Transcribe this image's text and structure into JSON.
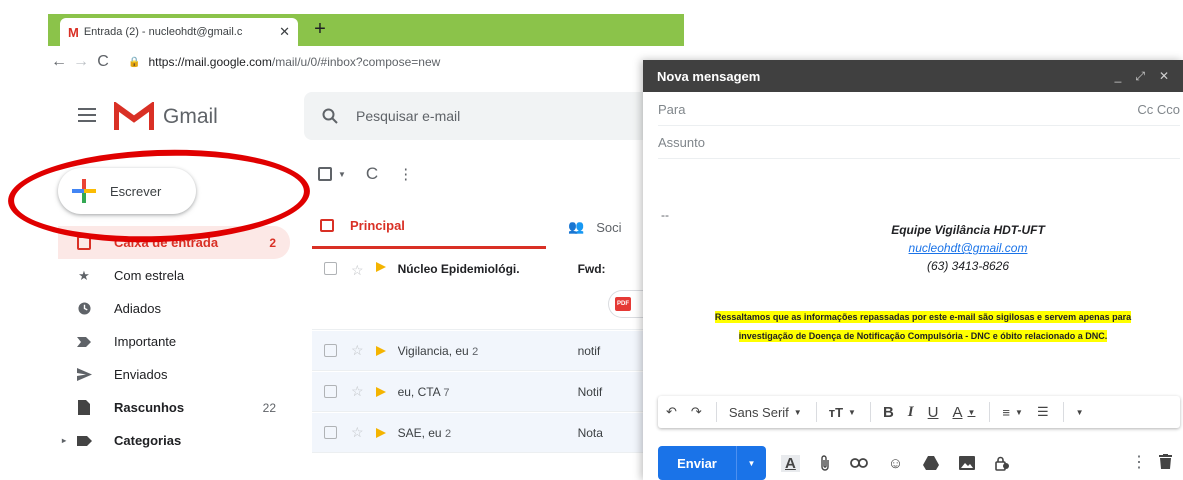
{
  "browser": {
    "tab_title": "Entrada (2) - nucleohdt@gmail.c",
    "tab_icon": "gmail-icon",
    "url_host": "https://mail.google.com",
    "url_path": "/mail/u/0/#inbox?compose=new"
  },
  "gmail": {
    "logo_text": "Gmail",
    "search_placeholder": "Pesquisar e-mail",
    "compose_label": "Escrever",
    "sidebar": [
      {
        "icon": "inbox-icon",
        "label": "Caixa de entrada",
        "count": "2"
      },
      {
        "icon": "star-icon",
        "label": "Com estrela",
        "count": ""
      },
      {
        "icon": "clock-icon",
        "label": "Adiados",
        "count": ""
      },
      {
        "icon": "important-icon",
        "label": "Importante",
        "count": ""
      },
      {
        "icon": "send-icon",
        "label": "Enviados",
        "count": ""
      },
      {
        "icon": "draft-icon",
        "label": "Rascunhos",
        "count": "22"
      },
      {
        "icon": "label-icon",
        "label": "Categorias",
        "count": ""
      }
    ],
    "tabs": {
      "principal": "Principal",
      "social": "Soci"
    },
    "emails": [
      {
        "sender": "Núcleo Epidemiológi.",
        "count": "",
        "subject": "Fwd:",
        "unread": true
      },
      {
        "sender": "Vigilancia, eu",
        "count": "2",
        "subject": "notif",
        "unread": false
      },
      {
        "sender": "eu, CTA",
        "count": "7",
        "subject": "Notif",
        "unread": false
      },
      {
        "sender": "SAE, eu",
        "count": "2",
        "subject": "Nota",
        "unread": false
      }
    ],
    "attachment_badge": "PDF"
  },
  "compose": {
    "title": "Nova mensagem",
    "to_label": "Para",
    "cc_bcc": "Cc Cco",
    "subject_label": "Assunto",
    "signature_dash": "--",
    "signature_name": "Equipe Vigilância HDT-UFT",
    "signature_email": "nucleohdt@gmail.com",
    "signature_phone": "(63) 3413-8626",
    "notice_line1": "Ressaltamos que as informações repassadas por este e-mail são sigilosas e servem apenas para",
    "notice_line2": "investigação de Doença de Notificação Compulsória - DNC e óbito relacionado a DNC.",
    "font_name": "Sans Serif",
    "send_label": "Enviar"
  },
  "colors": {
    "gmail_red": "#d93025",
    "tab_green": "#8bc34a",
    "send_blue": "#1a73e8",
    "highlight_yellow": "#ffff00",
    "annotation_red": "#e00000"
  }
}
